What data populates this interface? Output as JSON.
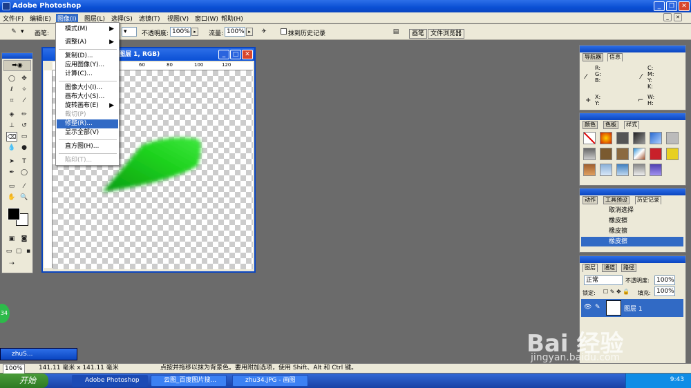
{
  "app": {
    "title": "Adobe Photoshop"
  },
  "menubar": {
    "items": [
      "文件(F)",
      "编辑(E)",
      "图像(I)",
      "图层(L)",
      "选择(S)",
      "滤镜(T)",
      "视图(V)",
      "窗口(W)",
      "帮助(H)"
    ]
  },
  "options": {
    "brush_label": "画笔:",
    "opacity_label": "不透明度:",
    "opacity_value": "100%",
    "flow_label": "流量:",
    "flow_value": "100%",
    "erase_history_label": "抹到历史记录",
    "tab_brush": "画笔",
    "tab_browser": "文件浏览器"
  },
  "document": {
    "title": "图层 1, RGB)",
    "ruler_marks": [
      "60",
      "80",
      "100",
      "120"
    ]
  },
  "image_menu": {
    "items": [
      "模式(M)",
      "调整(A)",
      "复制(D)...",
      "应用图像(Y)...",
      "计算(C)...",
      "图像大小(I)...",
      "画布大小(S)...",
      "旋转画布(E)",
      "裁切(P)",
      "修整(R)...",
      "显示全部(V)",
      "直方图(H)...",
      "陷印(T)..."
    ]
  },
  "navigator_panel": {
    "tabs": [
      "导航器",
      "信息"
    ],
    "rgb": "R:\nG:\nB:",
    "cmyk": "C:\nM:\nY:\nK:",
    "xy": "X:\nY:",
    "wh": "W:\nH:"
  },
  "swatches_panel": {
    "tabs": [
      "颜色",
      "色板",
      "样式"
    ]
  },
  "history_panel": {
    "tabs": [
      "动作",
      "工具预设",
      "历史记录"
    ],
    "items": [
      "取消选择",
      "橡皮擦",
      "橡皮擦",
      "橡皮擦"
    ]
  },
  "layers_panel": {
    "tabs": [
      "图层",
      "通道",
      "路径"
    ],
    "blend_mode": "正常",
    "opacity_label": "不透明度:",
    "opacity_value": "100%",
    "lock_label": "锁定:",
    "fill_label": "填充:",
    "fill_value": "100%",
    "layer_name": "图层 1"
  },
  "minimized_doc": {
    "title": "zhuS..."
  },
  "statusbar": {
    "zoom": "100%",
    "size": "141.11 毫米 x 141.11 毫米",
    "hint": "点按并拖移以抹为背景色。要用附加选项，使用 Shift、Alt 和 Ctrl 键。"
  },
  "taskbar": {
    "start": "开始",
    "items": [
      "Adobe Photoshop",
      "云图_百度图片搜...",
      "zhu34.JPG - 画图"
    ],
    "clock": "9:43"
  },
  "watermark": {
    "text": "Bai 经验",
    "url": "jingyan.baidu.com"
  },
  "side_badge": "34"
}
